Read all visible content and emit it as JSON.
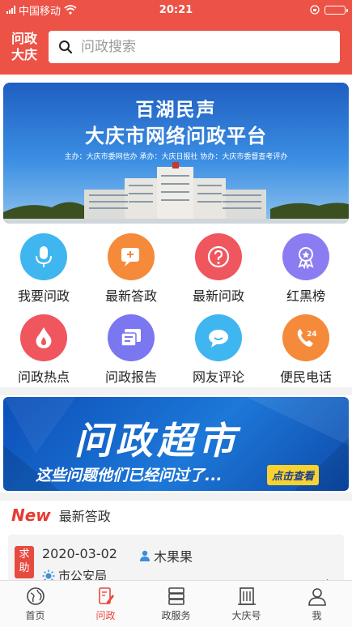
{
  "status_bar": {
    "carrier": "中国移动",
    "time": "20:21"
  },
  "header": {
    "logo_line1": "问政",
    "logo_line2": "大庆",
    "search_placeholder": "问政搜索"
  },
  "banner": {
    "title": "百湖民声",
    "subtitle": "大庆市网络问政平台",
    "sponsors": "主办：大庆市委网信办   承办：大庆日报社   协办：大庆市委督查考评办"
  },
  "menu": [
    {
      "label": "我要问政",
      "icon": "microphone-icon",
      "color": "#3fb6f0"
    },
    {
      "label": "最新答政",
      "icon": "chat-plus-icon",
      "color": "#f48a3a"
    },
    {
      "label": "最新问政",
      "icon": "question-icon",
      "color": "#f0565e"
    },
    {
      "label": "红黑榜",
      "icon": "medal-icon",
      "color": "#8c7cf2"
    },
    {
      "label": "问政热点",
      "icon": "flame-icon",
      "color": "#f0565e"
    },
    {
      "label": "问政报告",
      "icon": "report-icon",
      "color": "#7b77f0"
    },
    {
      "label": "网友评论",
      "icon": "comment-icon",
      "color": "#3fb6f0"
    },
    {
      "label": "便民电话",
      "icon": "phone-24-icon",
      "color": "#f48a3a"
    }
  ],
  "promo": {
    "title": "问政超市",
    "subtitle": "这些问题他们已经问过了...",
    "button": "点击查看"
  },
  "latest": {
    "badge": "New",
    "title": "最新答政",
    "item": {
      "tag": "求助",
      "date": "2020-03-02",
      "user": "木果果",
      "department": "市公安局"
    }
  },
  "tabbar": [
    {
      "label": "首页",
      "icon": "home-icon",
      "active": false
    },
    {
      "label": "问政",
      "icon": "edit-doc-icon",
      "active": true
    },
    {
      "label": "政服务",
      "icon": "server-icon",
      "active": false
    },
    {
      "label": "大庆号",
      "icon": "building-icon",
      "active": false
    },
    {
      "label": "我",
      "icon": "user-icon",
      "active": false
    }
  ],
  "colors": {
    "brand": "#ec5246",
    "active_tab": "#e8483c"
  }
}
